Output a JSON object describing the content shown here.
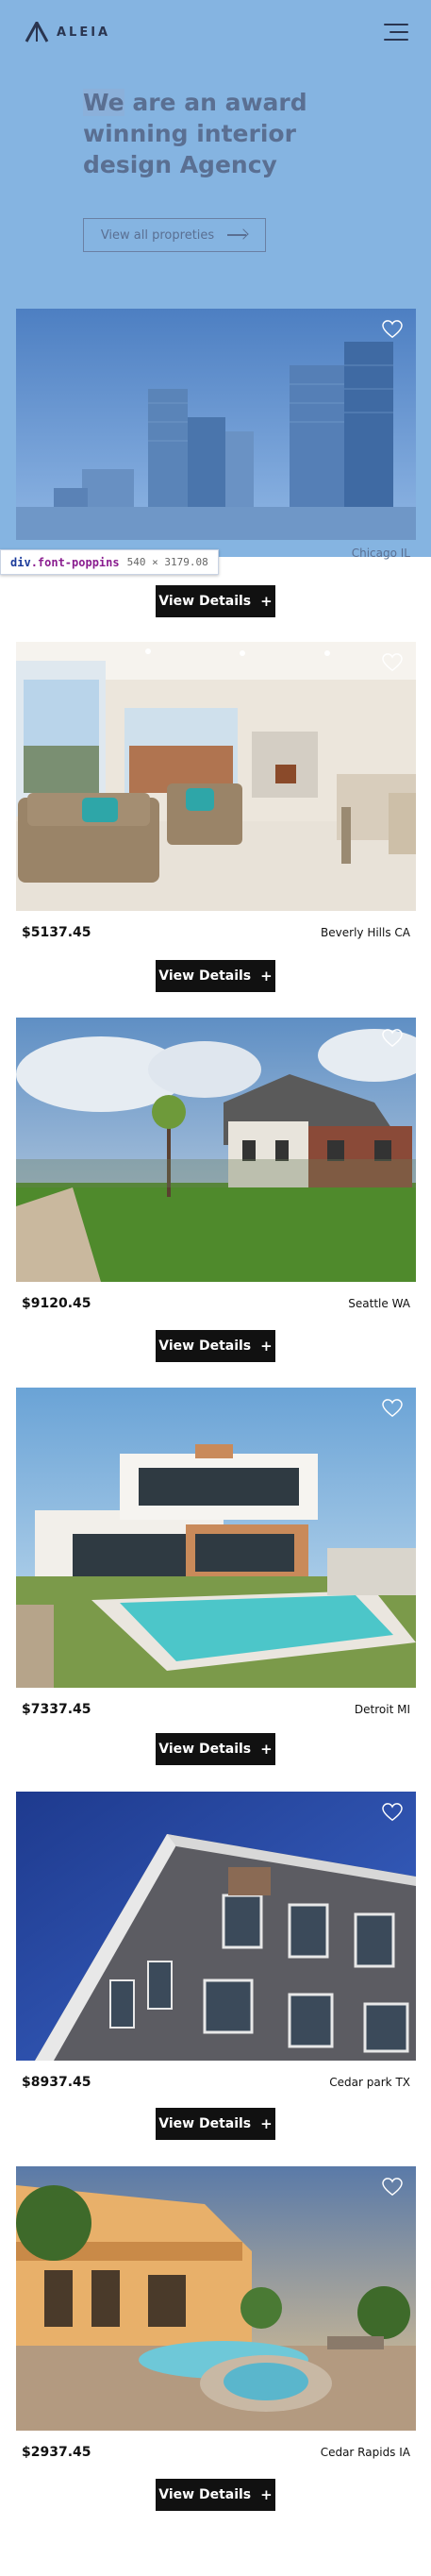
{
  "brand": {
    "logo_text": "ALEIA"
  },
  "hero": {
    "title_highlight": "We",
    "title_rest": " are an award winning interior design Agency",
    "cta_label": "View all propreties"
  },
  "inspector": {
    "selector_tag": "div",
    "selector_class": ".font-poppins",
    "dimensions": "540 × 3179.08"
  },
  "listings": [
    {
      "price": "",
      "city": "Chicago IL",
      "cta": "View Details",
      "scene": "city"
    },
    {
      "price": "$5137.45",
      "city": "Beverly Hills CA",
      "cta": "View Details",
      "scene": "interior"
    },
    {
      "price": "$9120.45",
      "city": "Seattle WA",
      "cta": "View Details",
      "scene": "suburb"
    },
    {
      "price": "$7337.45",
      "city": "Detroit MI",
      "cta": "View Details",
      "scene": "pool"
    },
    {
      "price": "$8937.45",
      "city": "Cedar park TX",
      "cta": "View Details",
      "scene": "facade"
    },
    {
      "price": "$2937.45",
      "city": "Cedar Rapids IA",
      "cta": "View Details",
      "scene": "patio"
    }
  ],
  "colors": {
    "overlay": "#6fa8dc",
    "button": "#111111",
    "hero_text": "#5a6f92"
  },
  "icons": {
    "heart": "heart-icon",
    "menu": "hamburger-menu-icon",
    "plus": "plus-icon",
    "arrow": "arrow-right-icon"
  }
}
